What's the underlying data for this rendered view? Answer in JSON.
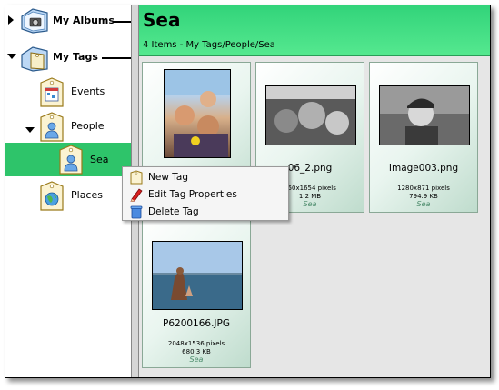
{
  "sidebar": {
    "albums_label": "My Albums",
    "tags_label": "My Tags",
    "items": [
      {
        "label": "Events"
      },
      {
        "label": "People"
      },
      {
        "label": "Sea"
      },
      {
        "label": "Places"
      }
    ]
  },
  "header": {
    "title": "Sea",
    "subtitle": "4 Items - My Tags/People/Sea"
  },
  "photos": [
    {
      "name": "",
      "dims": "",
      "size": "",
      "tag": ""
    },
    {
      "name": "06_2.png",
      "dims": "450x1654 pixels",
      "size": "1.2 MB",
      "tag": "Sea"
    },
    {
      "name": "Image003.png",
      "dims": "1280x871 pixels",
      "size": "794.9 KB",
      "tag": "Sea"
    },
    {
      "name": "P6200166.JPG",
      "dims": "2048x1536 pixels",
      "size": "680.3 KB",
      "tag": "Sea"
    }
  ],
  "menu": {
    "items": [
      {
        "label": "New Tag",
        "icon": "tag-icon"
      },
      {
        "label": "Edit Tag Properties",
        "icon": "pencil-icon"
      },
      {
        "label": "Delete Tag",
        "icon": "trash-icon"
      }
    ]
  },
  "colors": {
    "accent": "#2ec46a",
    "header": "#3fdc80"
  }
}
